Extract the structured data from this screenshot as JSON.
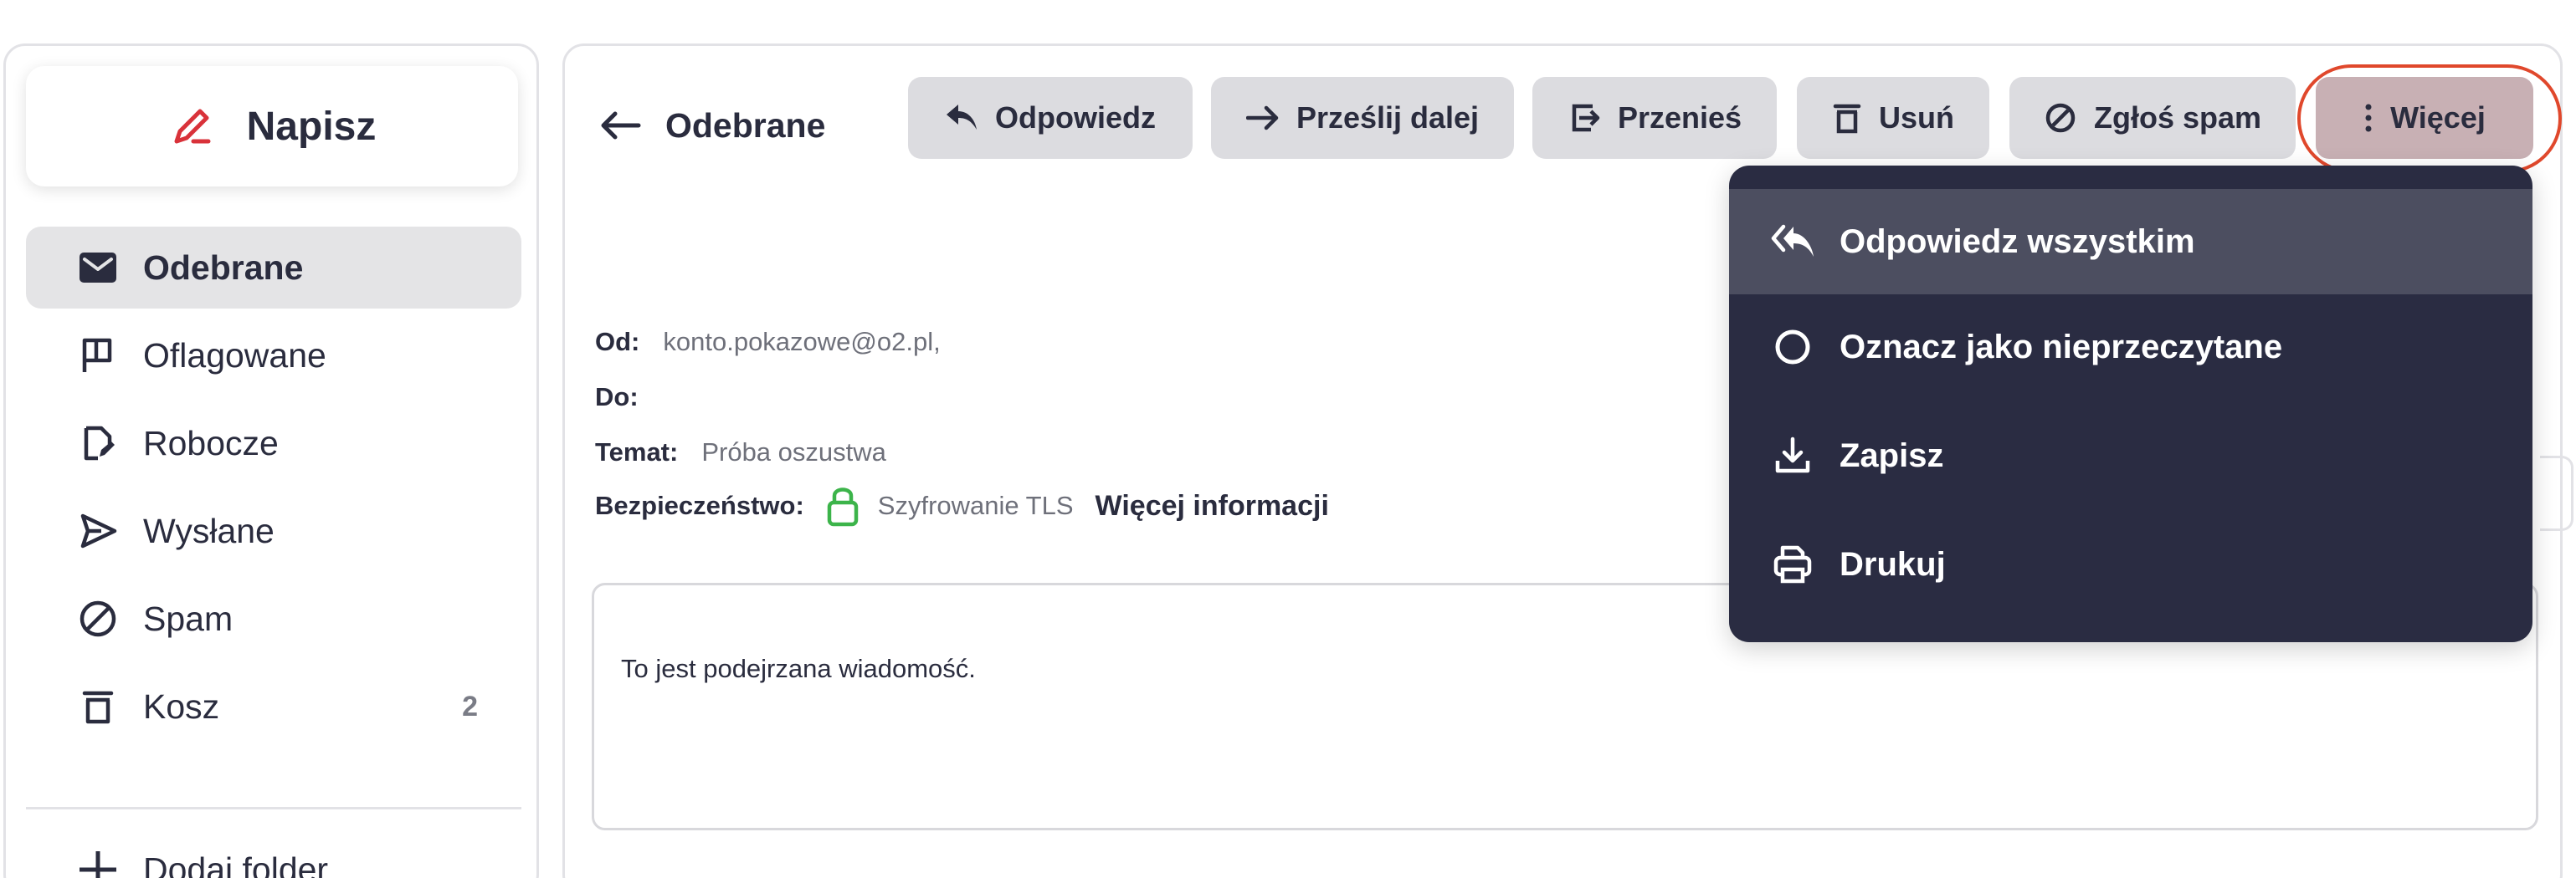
{
  "compose": {
    "label": "Napisz"
  },
  "nav": {
    "items": [
      {
        "label": "Odebrane",
        "icon": "envelope-icon",
        "active": true
      },
      {
        "label": "Oflagowane",
        "icon": "flag-icon"
      },
      {
        "label": "Robocze",
        "icon": "draft-icon"
      },
      {
        "label": "Wysłane",
        "icon": "send-icon"
      },
      {
        "label": "Spam",
        "icon": "spam-icon"
      },
      {
        "label": "Kosz",
        "icon": "trash-icon",
        "count": "2"
      }
    ],
    "add_folder": "Dodaj folder"
  },
  "header": {
    "back_label": "Odebrane"
  },
  "toolbar": {
    "reply": "Odpowiedz",
    "forward": "Prześlij dalej",
    "move": "Przenieś",
    "delete": "Usuń",
    "report_spam": "Zgłoś spam",
    "more": "Więcej"
  },
  "message": {
    "from_label": "Od:",
    "from_value": "konto.pokazowe@o2.pl,",
    "to_label": "Do:",
    "subject_label": "Temat:",
    "subject_value": "Próba oszustwa",
    "security_label": "Bezpieczeństwo:",
    "security_value": "Szyfrowanie TLS",
    "more_info": "Więcej informacji",
    "body": "To jest podejrzana wiadomość."
  },
  "dropdown": {
    "items": [
      {
        "label": "Odpowiedz wszystkim",
        "icon": "reply-all-icon"
      },
      {
        "label": "Oznacz jako nieprzeczytane",
        "icon": "circle-icon"
      },
      {
        "label": "Zapisz",
        "icon": "download-icon"
      },
      {
        "label": "Drukuj",
        "icon": "printer-icon"
      }
    ]
  },
  "colors": {
    "accent_red": "#e0482c",
    "compose_icon": "#d9323a",
    "lock_green": "#3cb44a",
    "dropdown_bg": "#2a2c42",
    "dropdown_hover": "#4c4e60",
    "button_bg": "#dcdce0"
  }
}
